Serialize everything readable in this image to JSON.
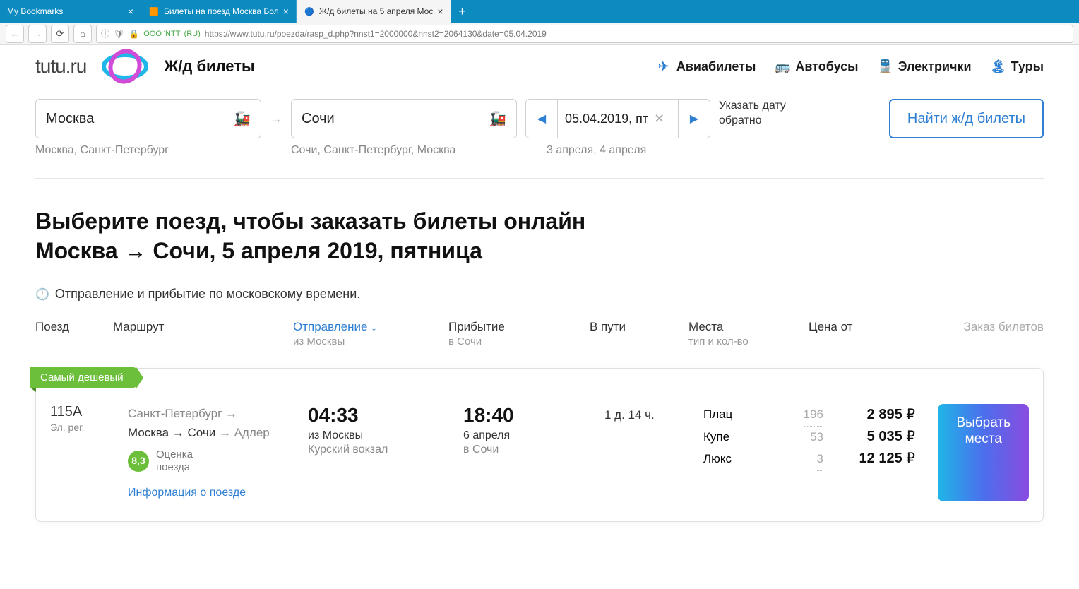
{
  "browser": {
    "tabs": [
      {
        "label": "My Bookmarks",
        "active": false
      },
      {
        "label": "Билеты на поезд Москва Бол",
        "active": false
      },
      {
        "label": "Ж/д билеты на 5 апреля Мос",
        "active": true
      }
    ],
    "url_identity": "OOO 'NTT' (RU)",
    "url": "https://www.tutu.ru/poezda/rasp_d.php?nnst1=2000000&nnst2=2064130&date=05.04.2019"
  },
  "header": {
    "logo_text": "tutu.ru",
    "subtitle": "Ж/д билеты",
    "nav": [
      {
        "icon": "plane",
        "label": "Авиабилеты"
      },
      {
        "icon": "bus",
        "label": "Автобусы"
      },
      {
        "icon": "elec",
        "label": "Электрички"
      },
      {
        "icon": "tour",
        "label": "Туры"
      }
    ]
  },
  "search": {
    "from": "Москва",
    "to": "Сочи",
    "date_display": "05.04.2019, пт",
    "return_hint": "Указать дату обратно",
    "find_label": "Найти ж/д билеты",
    "suggestions_from": "Москва, Санкт-Петербург",
    "suggestions_to": "Сочи, Санкт-Петербург, Москва",
    "suggestions_date": "3 апреля, 4 апреля"
  },
  "title_line1": "Выберите поезд, чтобы заказать билеты онлайн",
  "title_line2": "Москва → Сочи, 5 апреля 2019, пятница",
  "timezone_note": "Отправление и прибытие по московскому времени.",
  "columns": {
    "train": "Поезд",
    "route": "Маршрут",
    "departure": "Отправление ↓",
    "departure_sub": "из Москвы",
    "arrival": "Прибытие",
    "arrival_sub": "в Сочи",
    "duration": "В пути",
    "seats": "Места",
    "seats_sub": "тип и кол-во",
    "price": "Цена от",
    "order": "Заказ билетов"
  },
  "train": {
    "badge_cheapest": "Самый дешевый",
    "number": "115А",
    "sub": "Эл. рег.",
    "route_before": "Санкт-Петербург →",
    "route_active": "Москва → Сочи",
    "route_after": "→ Адлер",
    "rating_value": "8,3",
    "rating_label": "Оценка поезда",
    "info_link": "Информация о поезде",
    "dep_time": "04:33",
    "dep_sub": "из Москвы",
    "dep_station": "Курский вокзал",
    "arr_time": "18:40",
    "arr_date": "6 апреля",
    "arr_sub": "в Сочи",
    "duration": "1 д. 14 ч.",
    "seat_types": [
      {
        "name": "Плац",
        "count": "196",
        "price": "2 895"
      },
      {
        "name": "Купе",
        "count": "53",
        "price": "5 035"
      },
      {
        "name": "Люкс",
        "count": "3",
        "price": "12 125"
      }
    ],
    "select_label": "Выбрать места"
  }
}
